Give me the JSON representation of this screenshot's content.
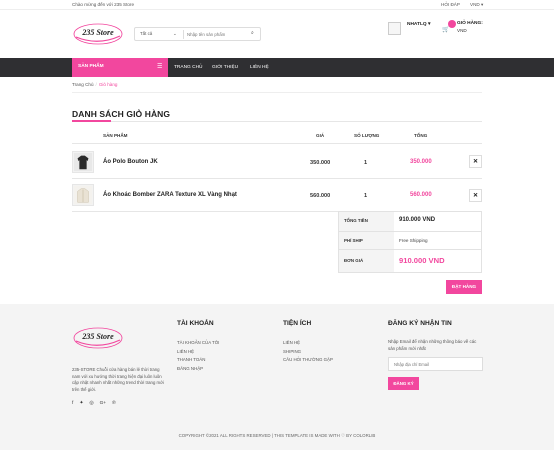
{
  "topbar": {
    "welcome": "Chào mừng đến với 235 Store",
    "help": "HỎI ĐÁP",
    "currency": "VND ▾"
  },
  "logo": {
    "text": "235 Store"
  },
  "search": {
    "category": "Tất cả",
    "placeholder": "Nhập tên sản phẩm"
  },
  "user": {
    "name": "NHATLQ ▾"
  },
  "cart": {
    "label": "GIỎ HÀNG:",
    "sub": "VND"
  },
  "nav": {
    "category_label": "SẢN PHẨM",
    "links": [
      "TRANG CHỦ",
      "GIỚI THIỆU",
      "LIÊN HỆ"
    ]
  },
  "breadcrumb": {
    "home": "Trang Chủ",
    "current": "Giỏ hàng"
  },
  "page": {
    "title": "DANH SÁCH GIỎ HÀNG"
  },
  "table": {
    "headers": [
      "SẢN PHẨM",
      "GIÁ",
      "SỐ LƯỢNG",
      "TỔNG"
    ],
    "rows": [
      {
        "name": "Áo Polo Bouton JK",
        "price": "350.000",
        "qty": "1",
        "total": "350.000"
      },
      {
        "name": "Áo Khoác Bomber ZARA Texture XL Vàng Nhạt",
        "price": "560.000",
        "qty": "1",
        "total": "560.000"
      }
    ]
  },
  "summary": {
    "subtotal_label": "TỔNG TIỀN",
    "subtotal": "910.000 VND",
    "ship_label": "PHÍ SHIP",
    "ship": "Free Shipping",
    "total_label": "ĐƠN GIÁ",
    "total": "910.000 VND",
    "checkout": "ĐẶT HÀNG"
  },
  "footer": {
    "desc": "235-STORE Chuỗi cửa hàng bán lẻ thời trang nam với xu hướng thời trang hiện đại luôn luôn cập nhật nhanh nhất những trend thời trang mới trên thế giới.",
    "col_account": {
      "title": "TÀI KHOẢN",
      "links": [
        "TÀI KHOẢN CỦA TÔI",
        "LIÊN HỆ",
        "THANH TOÁN",
        "ĐĂNG NHẬP"
      ]
    },
    "col_util": {
      "title": "TIỆN ÍCH",
      "links": [
        "LIÊN HỆ",
        "SHIPING",
        "CÂU HỎI THƯỜNG GẶP"
      ]
    },
    "col_news": {
      "title": "ĐĂNG KÝ NHẬN TIN",
      "desc": "Nhập Email để nhận những thông báo về các sản phẩm mới nhất",
      "placeholder": "Nhập địa chỉ Email",
      "button": "ĐĂNG KÝ"
    },
    "copyright": "COPYRIGHT ©2021 ALL RIGHTS RESERVED | THIS TEMPLATE IS MADE WITH ♡ BY COLORLIB"
  },
  "colors": {
    "accent": "#f2479e",
    "nav": "#2f2f32"
  },
  "icons": [
    "search-icon",
    "user-icon",
    "cart-icon",
    "menu-icon",
    "close-icon",
    "facebook-icon",
    "twitter-icon",
    "instagram-icon",
    "google-plus-icon",
    "pinterest-icon"
  ]
}
